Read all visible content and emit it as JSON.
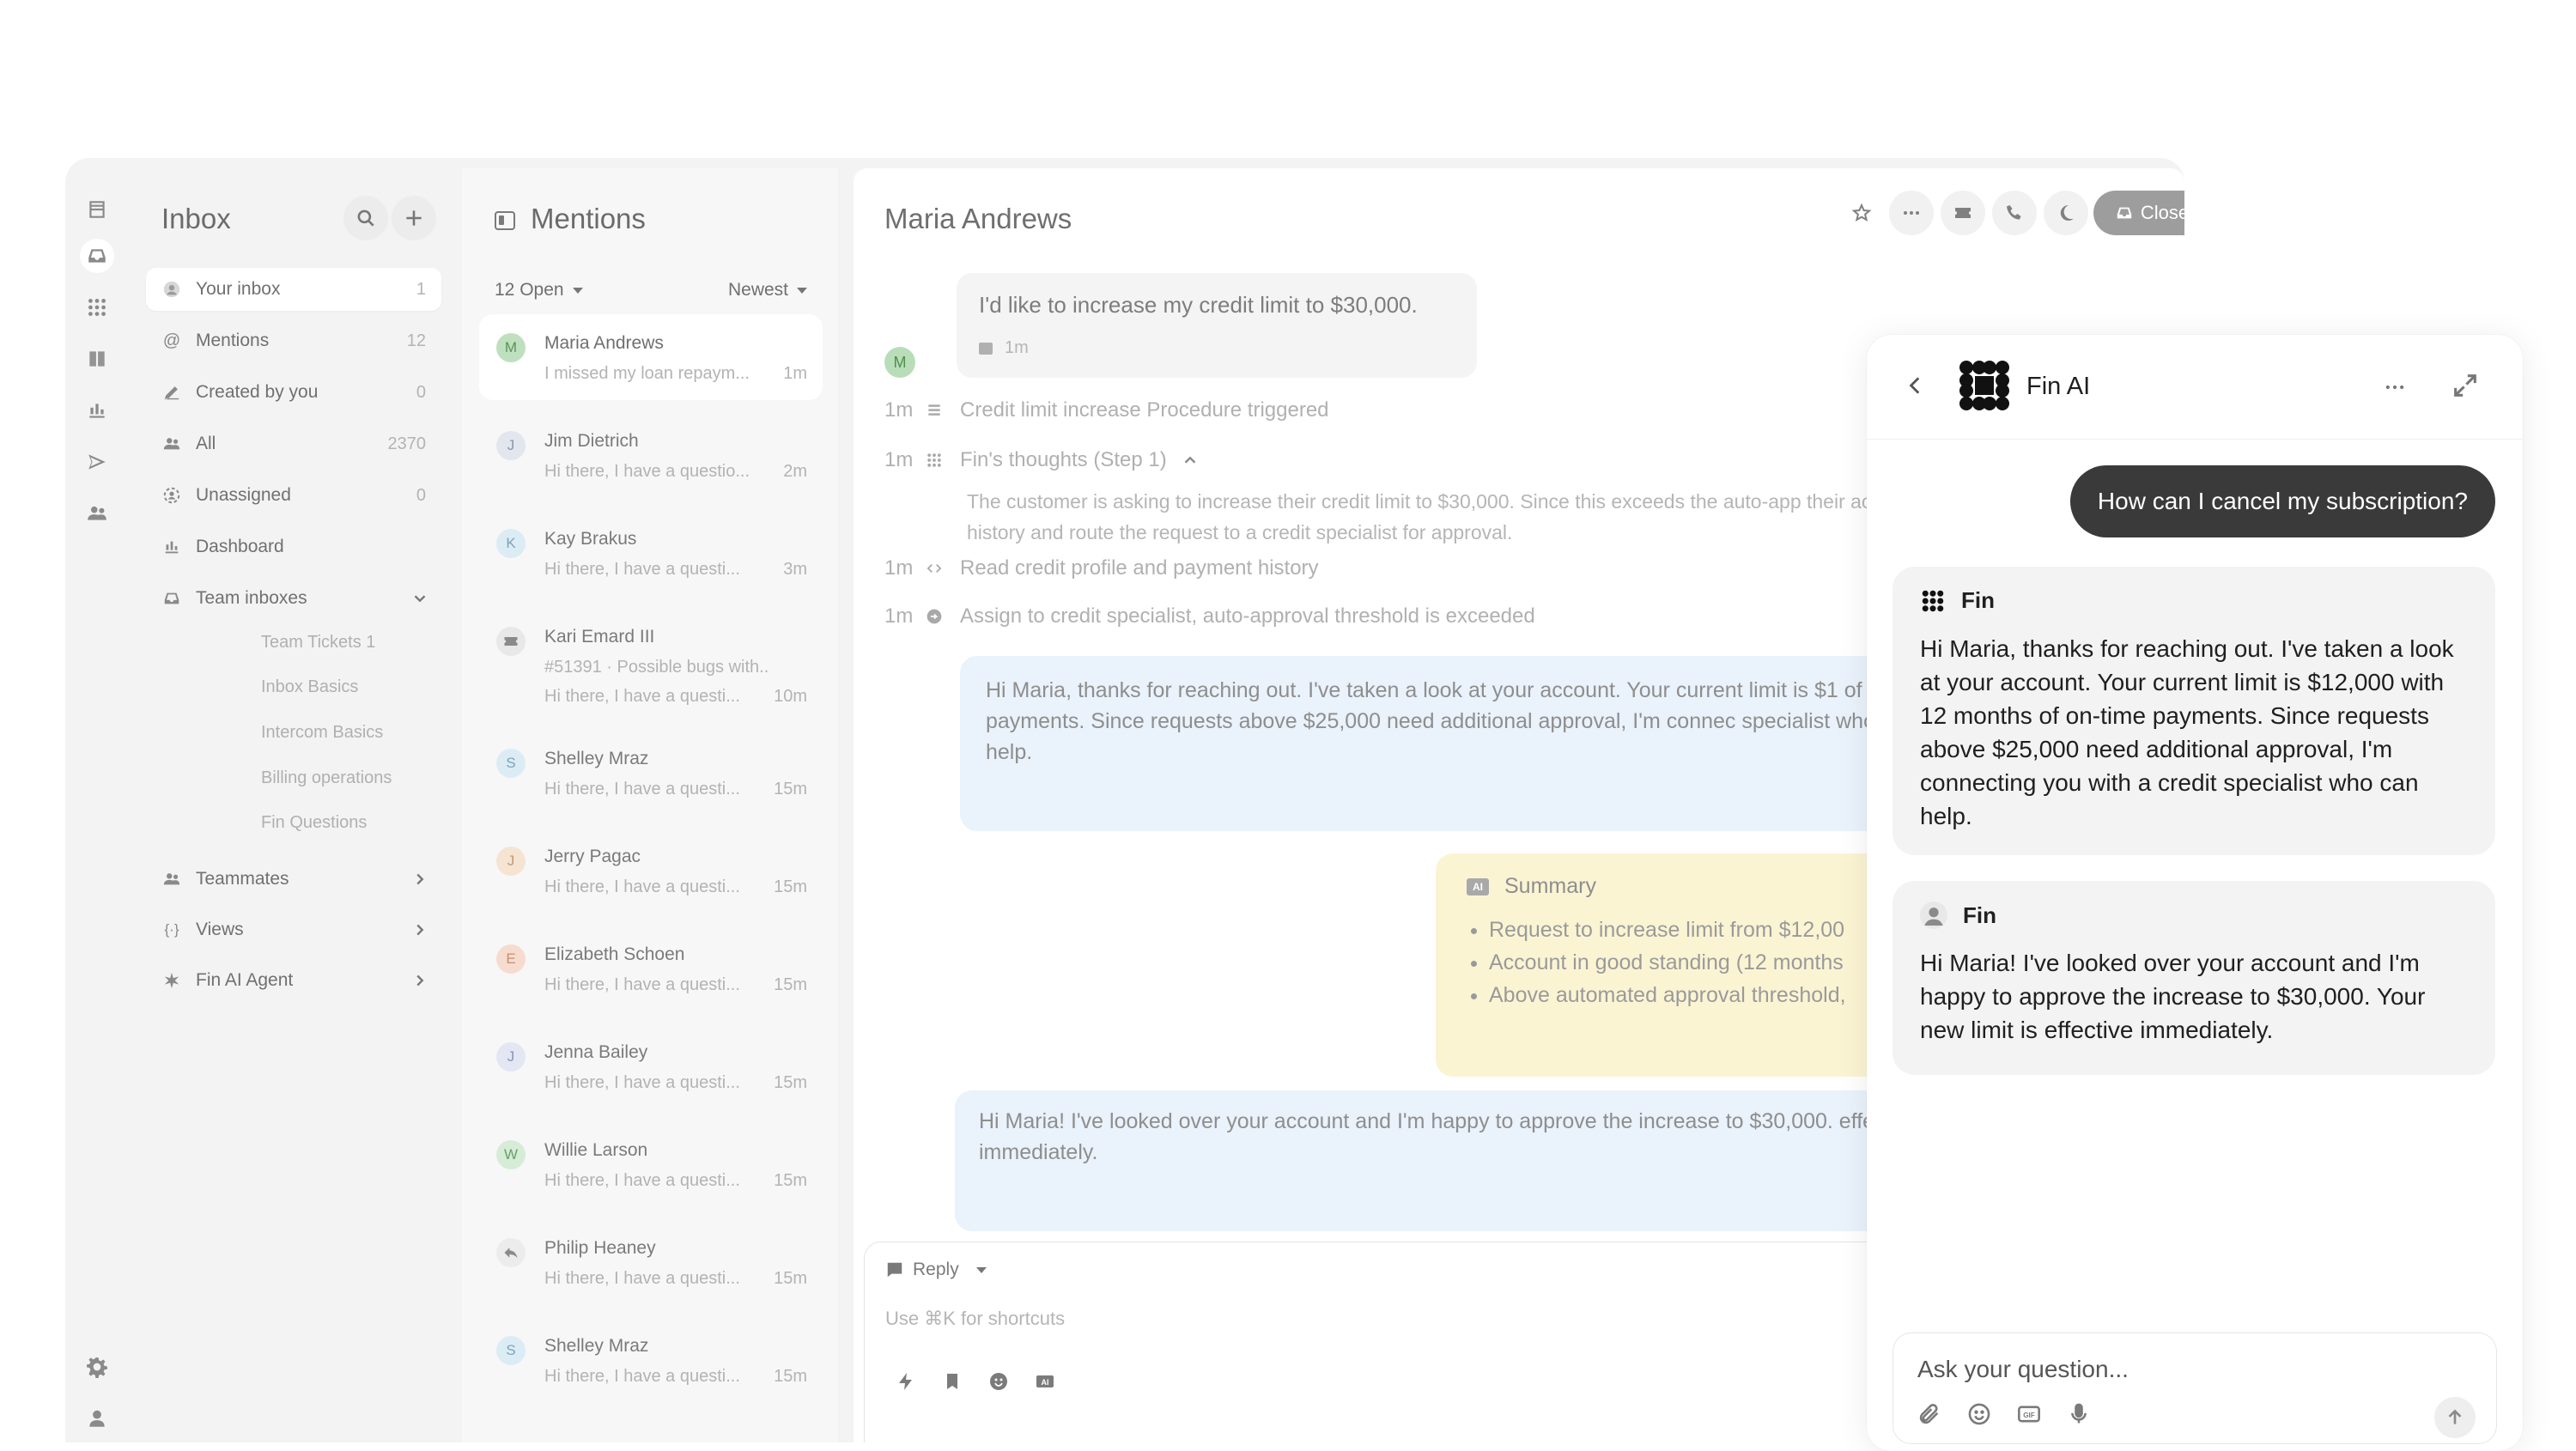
{
  "nav": {
    "title": "Inbox",
    "items": [
      {
        "label": "Your inbox",
        "count": "1"
      },
      {
        "label": "Mentions",
        "count": "12"
      },
      {
        "label": "Created by you",
        "count": "0"
      },
      {
        "label": "All",
        "count": "2370"
      },
      {
        "label": "Unassigned",
        "count": "0"
      },
      {
        "label": "Dashboard"
      },
      {
        "label": "Team inboxes"
      },
      {
        "label": "Teammates"
      },
      {
        "label": "Views"
      },
      {
        "label": "Fin AI Agent"
      }
    ],
    "team_inboxes": [
      "Team Tickets 1",
      "Inbox Basics",
      "Intercom Basics",
      "Billing operations",
      "Fin Questions"
    ]
  },
  "list": {
    "title": "Mentions",
    "filter_open": "12 Open",
    "sort": "Newest",
    "conversations": [
      {
        "initial": "M",
        "name": "Maria Andrews",
        "snippet": "I missed my loan repaym...",
        "time": "1m"
      },
      {
        "initial": "J",
        "name": "Jim Dietrich",
        "snippet": "Hi there, I have a questio...",
        "time": "2m"
      },
      {
        "initial": "K",
        "name": "Kay Brakus",
        "snippet": "Hi there, I have a questi...",
        "time": "3m"
      },
      {
        "initial": "",
        "name": "Kari Emard III",
        "subject": "#51391 · Possible bugs with...",
        "snippet": "Hi there, I have a questi...",
        "time": "10m"
      },
      {
        "initial": "S",
        "name": "Shelley Mraz",
        "snippet": "Hi there, I have a questi...",
        "time": "15m"
      },
      {
        "initial": "J",
        "name": "Jerry Pagac",
        "snippet": "Hi there, I have a questi...",
        "time": "15m"
      },
      {
        "initial": "E",
        "name": "Elizabeth Schoen",
        "snippet": "Hi there, I have a questi...",
        "time": "15m"
      },
      {
        "initial": "J",
        "name": "Jenna Bailey",
        "snippet": "Hi there, I have a questi...",
        "time": "15m"
      },
      {
        "initial": "W",
        "name": "Willie Larson",
        "snippet": "Hi there, I have a questi...",
        "time": "15m"
      },
      {
        "initial": "",
        "name": "Philip Heaney",
        "snippet": "Hi there, I have a questi...",
        "time": "15m"
      },
      {
        "initial": "S",
        "name": "Shelley Mraz",
        "snippet": "Hi there, I have a questi...",
        "time": "15m"
      }
    ]
  },
  "conversation": {
    "title": "Maria Andrews",
    "close_label": "Close",
    "customer_avatar": "M",
    "customer_message": "I'd like to increase my credit limit to $30,000.",
    "customer_message_time": "1m",
    "events": [
      {
        "time": "1m",
        "text": "Credit limit increase Procedure triggered"
      },
      {
        "time": "1m",
        "text": "Fin's thoughts (Step 1)"
      },
      {
        "time": "1m",
        "text": "Read credit profile and payment history"
      },
      {
        "time": "1m",
        "text": "Assign to credit specialist, auto-approval threshold is exceeded"
      }
    ],
    "thought_text": "The customer is asking to increase their credit limit to $30,000. Since this exceeds the auto-app their account history and route the request to a credit specialist for approval.",
    "fin_reply": "Hi Maria, thanks for reaching out. I've taken a look at your account. Your current limit is $1 of on-time payments. Since requests above $25,000 need additional approval, I'm connec specialist who can help.",
    "summary_title": "Summary",
    "summary_items": [
      "Request to increase limit from $12,00",
      "Account in good standing (12 months",
      "Above automated approval threshold,"
    ],
    "agent_reply": "Hi Maria! I've looked over your account and I'm happy to approve the increase to $30,000. effective immediately.",
    "composer_mode": "Reply",
    "composer_placeholder": "Use ⌘K for shortcuts"
  },
  "fin_panel": {
    "title": "Fin AI",
    "user_message": "How can I cancel my subscription?",
    "messages": [
      {
        "author": "Fin",
        "text": "Hi Maria, thanks for reaching out. I've taken a look at your account. Your current limit is $12,000 with 12 months of on-time payments. Since requests above $25,000 need additional approval, I'm connecting you with a credit specialist who can help."
      },
      {
        "author": "Fin",
        "text": "Hi Maria! I've looked over your account and I'm happy to approve the increase to $30,000. Your new limit is effective immediately."
      }
    ],
    "input_placeholder": "Ask your question..."
  }
}
